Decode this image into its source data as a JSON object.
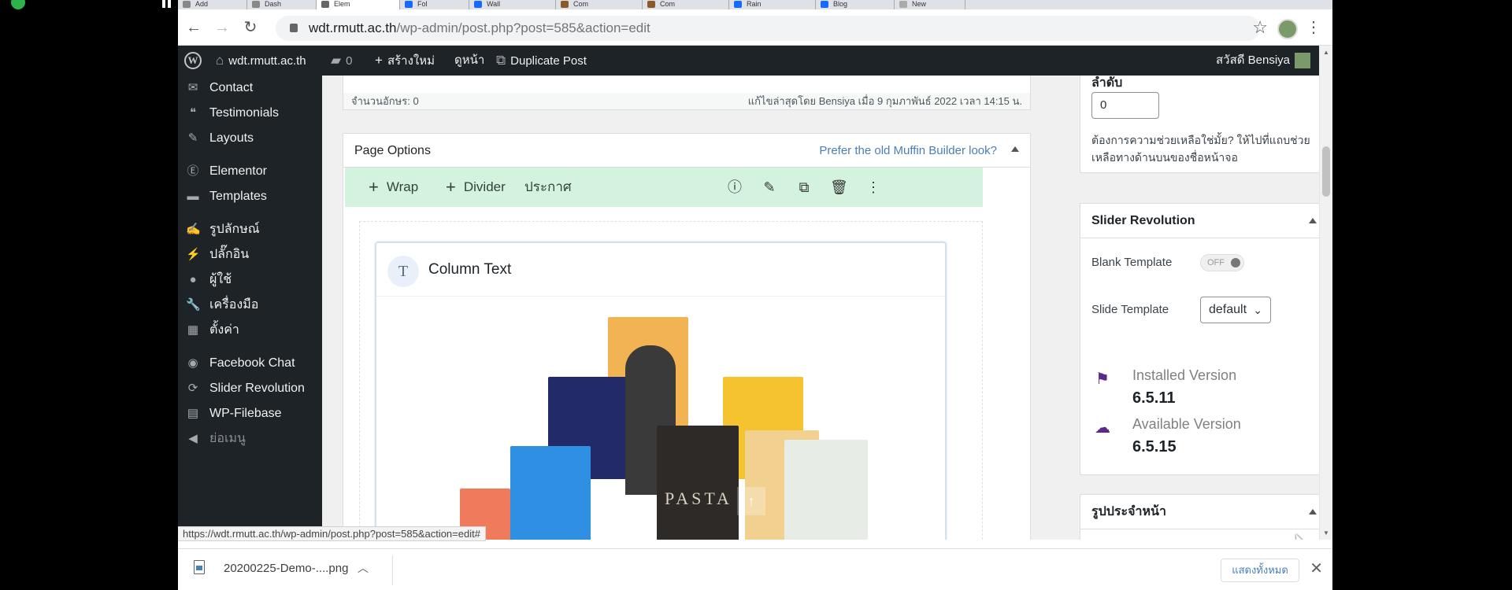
{
  "browser": {
    "tabs": [
      {
        "label": "Add",
        "color": "#888"
      },
      {
        "label": "Dash",
        "color": "#888"
      },
      {
        "label": "Elem",
        "color": "#666",
        "active": true
      },
      {
        "label": "Fol",
        "color": "#1769ff"
      },
      {
        "label": "Wall",
        "color": "#1769ff"
      },
      {
        "label": "Com",
        "color": "#8a5a2a"
      },
      {
        "label": "Com",
        "color": "#8a5a2a"
      },
      {
        "label": "Rain",
        "color": "#1769ff"
      },
      {
        "label": "Blog",
        "color": "#1769ff"
      },
      {
        "label": "New",
        "color": "#aaa"
      }
    ],
    "url_host": "wdt.rmutt.ac.th",
    "url_path": "/wp-admin/post.php?post=585&action=edit",
    "status_url": "https://wdt.rmutt.ac.th/wp-admin/post.php?post=585&action=edit#"
  },
  "adminbar": {
    "site": "wdt.rmutt.ac.th",
    "comments": "0",
    "new": "สร้างใหม่",
    "view": "ดูหน้า",
    "duplicate": "Duplicate Post",
    "greeting": "สวัสดี Bensiya"
  },
  "menu": [
    {
      "label": "Contact",
      "icon": "envelope-icon",
      "glyph": "✉"
    },
    {
      "label": "Testimonials",
      "icon": "quote-icon",
      "glyph": "❝"
    },
    {
      "label": "Layouts",
      "icon": "pencil-icon",
      "glyph": "✎"
    },
    {
      "label": "Elementor",
      "icon": "elementor-icon",
      "glyph": "Ⓔ"
    },
    {
      "label": "Templates",
      "icon": "folder-icon",
      "glyph": "▬"
    },
    {
      "label": "รูปลักษณ์",
      "icon": "brush-icon",
      "glyph": "✍"
    },
    {
      "label": "ปลั๊กอิน",
      "icon": "plugin-icon",
      "glyph": "⚡"
    },
    {
      "label": "ผู้ใช้",
      "icon": "user-icon",
      "glyph": "●"
    },
    {
      "label": "เครื่องมือ",
      "icon": "wrench-icon",
      "glyph": "🔧"
    },
    {
      "label": "ตั้งค่า",
      "icon": "settings-icon",
      "glyph": "▦"
    },
    {
      "label": "Facebook Chat",
      "icon": "messenger-icon",
      "glyph": "◉"
    },
    {
      "label": "Slider Revolution",
      "icon": "refresh-icon",
      "glyph": "⟳"
    },
    {
      "label": "WP-Filebase",
      "icon": "file-icon",
      "glyph": "▤"
    },
    {
      "label": "ย่อเมนู",
      "icon": "collapse-icon",
      "glyph": "◀"
    }
  ],
  "editor": {
    "word_count": "จำนวนอักษร: 0",
    "last_edited": "แก้ไขล่าสุดโดย Bensiya เมื่อ 9 กุมภาพันธ์ 2022 เวลา 14:15 น."
  },
  "page_options": {
    "title": "Page Options",
    "link": "Prefer the old Muffin Builder look?",
    "toolbar": {
      "wrap": "Wrap",
      "divider": "Divider",
      "announce": "ประกาศ"
    },
    "column_title": "Column Text",
    "preview_text": "PASTA"
  },
  "sidebar": {
    "order": {
      "title": "ลำดับ",
      "value": "0",
      "help": "ต้องการความช่วยเหลือใช่มั้ย? ให้ไปที่แถบช่วยเหลือทางด้านบนของชื่อหน้าจอ"
    },
    "slider": {
      "title": "Slider Revolution",
      "blank_label": "Blank Template",
      "blank_state": "OFF",
      "slide_label": "Slide Template",
      "slide_value": "default",
      "installed_label": "Installed Version",
      "installed_value": "6.5.11",
      "available_label": "Available Version",
      "available_value": "6.5.15",
      "accent": "#5b2a86"
    },
    "featured": {
      "title": "รูปประจำหน้า"
    }
  },
  "downloads": {
    "file": "20200225-Demo-....png",
    "show_all": "แสดงทั้งหมด"
  }
}
